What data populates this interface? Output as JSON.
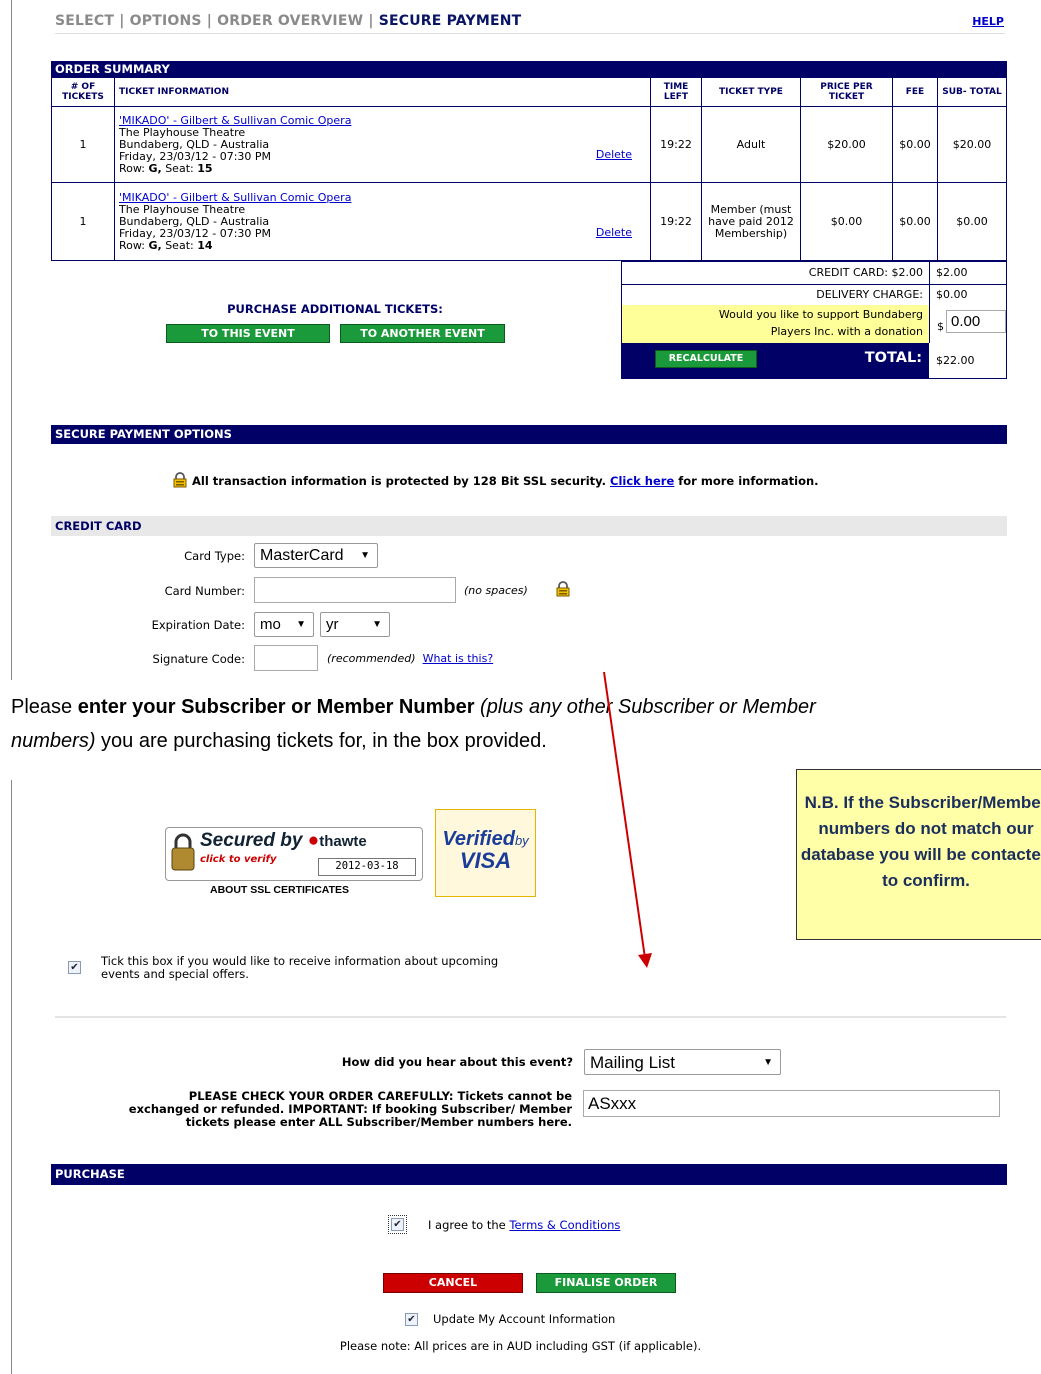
{
  "steps": {
    "select": "SELECT",
    "options": "OPTIONS",
    "overview": "ORDER OVERVIEW",
    "payment": "SECURE PAYMENT",
    "sep": "|"
  },
  "help_label": "HELP",
  "order_summary": {
    "title": "ORDER SUMMARY",
    "headers": {
      "num": "# OF TICKETS",
      "info": "TICKET INFORMATION",
      "time": "TIME LEFT",
      "type": "TICKET TYPE",
      "price": "PRICE PER TICKET",
      "fee": "FEE",
      "subtotal": "SUB- TOTAL"
    },
    "rows": [
      {
        "qty": "1",
        "event": "'MIKADO' - Gilbert & Sullivan Comic Opera",
        "venue": "The Playhouse Theatre",
        "location": "Bundaberg, QLD - Australia",
        "datetime": "Friday, 23/03/12 - 07:30 PM",
        "row_label": "Row:",
        "row": "G,",
        "seat_label": "Seat:",
        "seat": "15",
        "delete": "Delete",
        "time_left": "19:22",
        "type": "Adult",
        "price": "$20.00",
        "fee": "$0.00",
        "subtotal": "$20.00"
      },
      {
        "qty": "1",
        "event": "'MIKADO' - Gilbert & Sullivan Comic Opera",
        "venue": "The Playhouse Theatre",
        "location": "Bundaberg, QLD - Australia",
        "datetime": "Friday, 23/03/12 - 07:30 PM",
        "row_label": "Row:",
        "row": "G,",
        "seat_label": "Seat:",
        "seat": "14",
        "delete": "Delete",
        "time_left": "19:22",
        "type": "Member (must have paid 2012 Membership)",
        "price": "$0.00",
        "fee": "$0.00",
        "subtotal": "$0.00"
      }
    ]
  },
  "totals": {
    "credit_card_label": "CREDIT CARD: $2.00",
    "credit_card_value": "$2.00",
    "delivery_label": "DELIVERY CHARGE:",
    "delivery_value": "$0.00",
    "donation_line1": "Would you like to support Bundaberg",
    "donation_line2": "Players Inc. with a donation",
    "donation_currency": "$",
    "donation_value": "0.00",
    "recalculate": "RECALCULATE",
    "total_label": "TOTAL:",
    "total_value": "$22.00"
  },
  "additional": {
    "title": "PURCHASE ADDITIONAL TICKETS:",
    "this_event": "TO THIS EVENT",
    "another_event": "TO ANOTHER EVENT"
  },
  "secure": {
    "title": "SECURE PAYMENT OPTIONS",
    "ssl_text": "All transaction information is protected by 128 Bit SSL security.",
    "click_here": "Click here",
    "more_info": "for more information."
  },
  "credit_card": {
    "title": "CREDIT CARD",
    "card_type_label": "Card Type:",
    "card_type_value": "MasterCard",
    "card_number_label": "Card Number:",
    "no_spaces": "(no spaces)",
    "expiry_label": "Expiration Date:",
    "month": "mo",
    "year": "yr",
    "signature_label": "Signature Code:",
    "recommended": "(recommended)",
    "what_is_this": "What is this?"
  },
  "doc_text": {
    "please": "Please ",
    "bold": "enter your Subscriber or Member Number",
    "italic1": " (plus any other Subscriber or Member",
    "italic2": "numbers)",
    "rest": " you are purchasing tickets for, in the box provided."
  },
  "note": {
    "text": "N.B. If the Subscriber/Member numbers do not match our database you will be contacted to confirm."
  },
  "badges": {
    "secured_by": "Secured by",
    "thawte": "thawte",
    "click_verify": "click to verify",
    "date": "2012-03-18",
    "about_ssl": "ABOUT SSL CERTIFICATES",
    "verified": "Verified",
    "by": "by",
    "visa": "VISA"
  },
  "offers": {
    "line1": "Tick this box if you would like to receive information about upcoming",
    "line2": "events and special offers.",
    "checked": true
  },
  "hear": {
    "label": "How did you hear about this event?",
    "value": "Mailing List"
  },
  "check_order": {
    "line1": "PLEASE CHECK YOUR ORDER CAREFULLY: Tickets cannot be",
    "line2": "exchanged or refunded. IMPORTANT: If booking Subscriber/ Member",
    "line3": "tickets please enter ALL Subscriber/Member numbers here.",
    "value": "ASxxx"
  },
  "purchase": {
    "title": "PURCHASE",
    "agree": "I agree to the",
    "terms": "Terms & Conditions",
    "cancel": "CANCEL",
    "finalise": "FINALISE ORDER",
    "update": "Update My Account Information",
    "prices_note": "Please note: All prices are in AUD including GST (if applicable)."
  },
  "colors": {
    "navy": "#000066",
    "green": "#1a9a3a",
    "red": "#cc0000",
    "note_bg": "#ffffa8",
    "highlight": "#ffff99",
    "arrow": "#cc0000"
  }
}
